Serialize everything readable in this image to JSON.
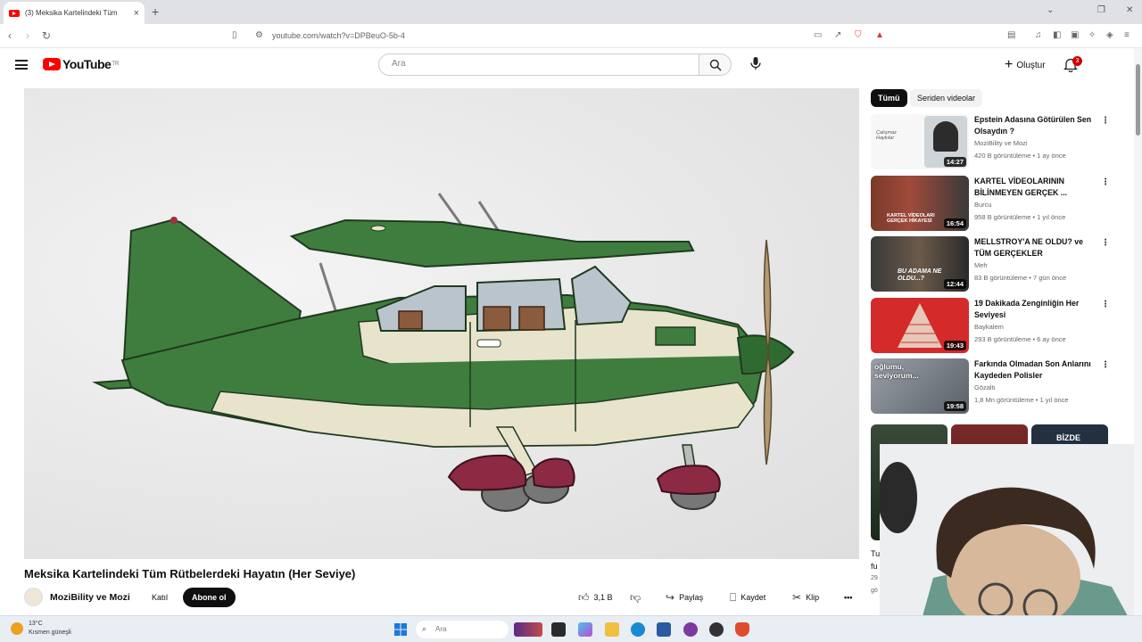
{
  "browser": {
    "tab_title": "(3) Meksika Kartelindeki Tüm",
    "tab_close": "×",
    "new_tab": "+",
    "url": "youtube.com/watch?v=DPBeuO-5b-4"
  },
  "header": {
    "logo_text": "YouTube",
    "logo_region": "TR",
    "search_placeholder": "Ara",
    "create_label": "Oluştur",
    "notifications_count": "3"
  },
  "video": {
    "title": "Meksika Kartelindeki Tüm Rütbelerdeki Hayatın (Her Seviye)",
    "channel": "MoziBility ve Mozi",
    "join_label": "Katıl",
    "subscribe_label": "Abone ol",
    "likes": "3,1 B",
    "share_label": "Paylaş",
    "save_label": "Kaydet",
    "clip_label": "Klip",
    "more_label": "•••"
  },
  "sidebar": {
    "chips": [
      "Tümü",
      "Seriden videolar"
    ],
    "recommendations": [
      {
        "title": "Epstein Adasına Götürülen Sen Olsaydın ?",
        "channel": "MoziBility ve Mozi",
        "meta": "420 B görüntüleme • 1 ay önce",
        "duration": "14:27",
        "thumb_text": "Çalışmaz Haykılar"
      },
      {
        "title": "KARTEL VİDEOLARININ BİLİNMEYEN GERÇEK ...",
        "channel": "Burcu",
        "meta": "958 B görüntüleme • 1 yıl önce",
        "duration": "16:54",
        "thumb_text": "KARTEL VİDEOLARI GERÇEK HİKAYESİ"
      },
      {
        "title": "MELLSTROY'A NE OLDU? ve TÜM GERÇEKLER",
        "channel": "Meh",
        "meta": "83 B görüntüleme • 7 gün önce",
        "duration": "12:44",
        "thumb_text": "BU ADAMA NE OLDU...?"
      },
      {
        "title": "19 Dakikada Zenginliğin Her Seviyesi",
        "channel": "Baykalem",
        "meta": "293 B görüntüleme • 6 ay önce",
        "duration": "19:43",
        "thumb_text": ""
      },
      {
        "title": "Farkında Olmadan Son Anlarını Kaydeden Polisler",
        "channel": "Gözaltı",
        "meta": "1,8 Mn görüntüleme • 1 yıl önce",
        "duration": "19:58",
        "thumb_text": "oğlumu, seviyorum..."
      }
    ],
    "shorts_labels": [
      "",
      "",
      "BİZDE"
    ],
    "cutoff_text": [
      "Tu",
      "fu",
      "29",
      "gö"
    ]
  },
  "taskbar": {
    "temperature": "13°C",
    "weather_desc": "Kısmen güneşli",
    "search_placeholder": "Ara"
  },
  "colors": {
    "youtube_red": "#ff0000",
    "plane_green": "#3f7d3f",
    "plane_cream": "#e8e4cc",
    "wheel_maroon": "#8c2a44"
  }
}
